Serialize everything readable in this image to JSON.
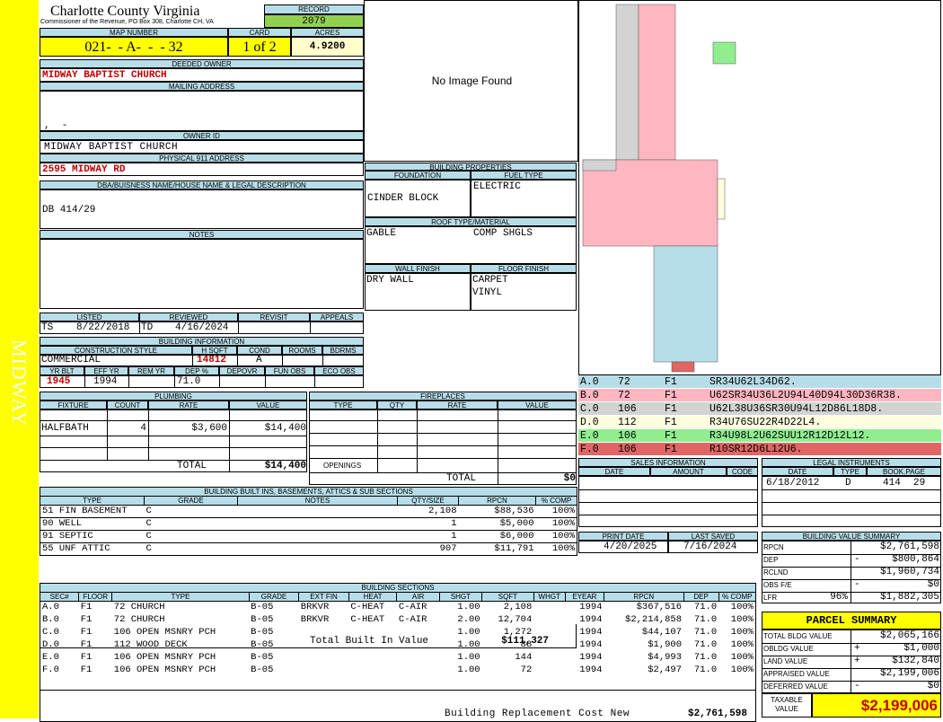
{
  "side_label": "MIDWAY",
  "header": {
    "county": "Charlotte County Virginia",
    "commissioner": "Commissioner of the Revenue, PO Box 308, Charlotte CH, VA",
    "record_label": "RECORD",
    "record": "2079",
    "map_label": "MAP NUMBER",
    "map_number": "021-  - A-  -  - 32",
    "card_label": "CARD",
    "card": "1 of 2",
    "acres_label": "ACRES",
    "acres": "4.9200"
  },
  "owner": {
    "deeded_label": "DEEDED OWNER",
    "deeded": "MIDWAY BAPTIST CHURCH",
    "mailing_label": "MAILING ADDRESS",
    "mailing": ",  -",
    "owner_id_label": "OWNER ID",
    "owner_id": "MIDWAY BAPTIST CHURCH",
    "physical_label": "PHYSICAL 911 ADDRESS",
    "physical": "2595 MIDWAY RD",
    "dba_label": "DBA/BUISNESS NAME/HOUSE NAME & LEGAL DESCRIPTION",
    "dba": "DB 414/29",
    "notes_label": "NOTES"
  },
  "image": {
    "text": "No Image Found"
  },
  "bldg_props": {
    "title": "BUILDING PROPERTIES",
    "foundation_label": "FOUNDATION",
    "foundation": "CINDER BLOCK",
    "fuel_label": "FUEL TYPE",
    "fuel": "ELECTRIC",
    "roof_label": "ROOF TYPE/MATERIAL",
    "roof_type": "GABLE",
    "roof_material": "COMP SHGLS",
    "wall_label": "WALL FINISH",
    "wall": "DRY WALL",
    "floor_label": "FLOOR FINISH",
    "floor1": "CARPET",
    "floor2": "VINYL"
  },
  "status": {
    "listed_label": "LISTED",
    "reviewed_label": "REVIEWED",
    "revisit_label": "REVISIT",
    "appeals_label": "APPEALS",
    "listed_by": "TS",
    "listed_date": "8/22/2018",
    "reviewed_by": "TD",
    "reviewed_date": "4/16/2024"
  },
  "bldg_info": {
    "title": "BUILDING INFORMATION",
    "style_label": "CONSTRUCTION STYLE",
    "hsqft_label": "H SQFT",
    "cond_label": "COND",
    "rooms_label": "ROOMS",
    "bdrms_label": "BDRMS",
    "style": "COMMERCIAL",
    "hsqft": "14812",
    "cond": "A",
    "yrblt_label": "YR BLT",
    "effyr_label": "EFF YR",
    "remyr_label": "REM YR",
    "dep_label": "DEP %",
    "depovr_label": "DEPOVR",
    "funobs_label": "FUN OBS",
    "ecoobs_label": "ECO OBS",
    "yrblt": "1945",
    "effyr": "1994",
    "dep": "71.0"
  },
  "plumbing": {
    "title": "PLUMBING",
    "headers": [
      "FIXTURE",
      "COUNT",
      "RATE",
      "VALUE"
    ],
    "fixture": "HALFBATH",
    "count": "4",
    "rate": "$3,600",
    "value": "$14,400",
    "total_label": "TOTAL",
    "total": "$14,400"
  },
  "fireplaces": {
    "title": "FIREPLACES",
    "headers": [
      "TYPE",
      "QTY",
      "RATE",
      "VALUE"
    ],
    "openings_label": "OPENINGS",
    "total_label": "TOTAL",
    "total": "$0"
  },
  "builtins": {
    "title": "BUILDING BUILT INS, BASEMENTS, ATTICS & SUB SECTIONS",
    "headers": [
      "TYPE",
      "GRADE",
      "NOTES",
      "QTY/SIZE",
      "RPCN",
      "% COMP"
    ],
    "rows": [
      [
        "51 FIN BASEMENT",
        "C",
        "",
        "2,108",
        "$88,536",
        "100%"
      ],
      [
        "90 WELL",
        "C",
        "",
        "1",
        "$5,000",
        "100%"
      ],
      [
        "91 SEPTIC",
        "C",
        "",
        "1",
        "$6,000",
        "100%"
      ],
      [
        "55 UNF ATTIC",
        "C",
        "",
        "907",
        "$11,791",
        "100%"
      ]
    ],
    "total_label": "Total Built In Value",
    "total": "$111,327"
  },
  "sections": {
    "title": "BUILDING SECTIONS",
    "headers": [
      "SEC#",
      "FLOOR",
      "TYPE",
      "GRADE",
      "EXT FIN",
      "HEAT",
      "AIR",
      "SHGT",
      "SQFT",
      "WHGT",
      "EYEAR",
      "RPCN",
      "DEP",
      "% COMP"
    ],
    "rows": [
      [
        "A.0",
        "F1",
        "72 CHURCH",
        "B-05",
        "BRKVR",
        "C-HEAT",
        "C-AIR",
        "1.00",
        "2,108",
        "",
        "1994",
        "$367,516",
        "71.0",
        "100%"
      ],
      [
        "B.0",
        "F1",
        "72 CHURCH",
        "B-05",
        "BRKVR",
        "C-HEAT",
        "C-AIR",
        "2.00",
        "12,704",
        "",
        "1994",
        "$2,214,858",
        "71.0",
        "100%"
      ],
      [
        "C.0",
        "F1",
        "106 OPEN MSNRY PCH",
        "B-05",
        "",
        "",
        "",
        "1.00",
        "1,272",
        "",
        "1994",
        "$44,107",
        "71.0",
        "100%"
      ],
      [
        "D.0",
        "F1",
        "112 WOOD DECK",
        "B-05",
        "",
        "",
        "",
        "1.00",
        "88",
        "",
        "1994",
        "$1,900",
        "71.0",
        "100%"
      ],
      [
        "E.0",
        "F1",
        "106 OPEN MSNRY PCH",
        "B-05",
        "",
        "",
        "",
        "1.00",
        "144",
        "",
        "1994",
        "$4,993",
        "71.0",
        "100%"
      ],
      [
        "F.0",
        "F1",
        "106 OPEN MSNRY PCH",
        "B-05",
        "",
        "",
        "",
        "1.00",
        "72",
        "",
        "1994",
        "$2,497",
        "71.0",
        "100%"
      ]
    ],
    "total_label": "Building Replacement Cost New",
    "total": "$2,761,598"
  },
  "sketch_legend": [
    {
      "sec": "A.0",
      "code": "72",
      "floor": "F1",
      "path": "SR34U62L34D62.",
      "color": "#b7dde8"
    },
    {
      "sec": "B.0",
      "code": "72",
      "floor": "F1",
      "path": "U62SR34U36L2U94L40D94L30D36R38.",
      "color": "#ffb6c1"
    },
    {
      "sec": "C.0",
      "code": "106",
      "floor": "F1",
      "path": "U62L38U36SR30U94L12D86L18D8.",
      "color": "#d3d3d3"
    },
    {
      "sec": "D.0",
      "code": "112",
      "floor": "F1",
      "path": "R34U76SU22R4D22L4.",
      "color": "#ffffe0"
    },
    {
      "sec": "E.0",
      "code": "106",
      "floor": "F1",
      "path": "R34U98L2U62SUU12R12D12L12.",
      "color": "#90ee90"
    },
    {
      "sec": "F.0",
      "code": "106",
      "floor": "F1",
      "path": "R10SR12D6L12U6.",
      "color": "#e06666"
    }
  ],
  "sales": {
    "title": "SALES INFORMATION",
    "headers": [
      "DATE",
      "AMOUNT",
      "CODE"
    ]
  },
  "legal": {
    "title": "LEGAL INSTRUMENTS",
    "headers": [
      "DATE",
      "TYPE",
      "BOOK.PAGE"
    ],
    "date": "6/18/2012",
    "type": "D",
    "book": "414",
    "page": "29"
  },
  "dates": {
    "print_label": "PRINT DATE",
    "print": "4/20/2025",
    "saved_label": "LAST SAVED",
    "saved": "7/16/2024"
  },
  "value_summary": {
    "title": "BUILDING VALUE SUMMARY",
    "rpcn_label": "RPCN",
    "rpcn": "$2,761,598",
    "dep_label": "DEP",
    "dep_sign": "-",
    "dep": "$800,864",
    "rclnd_label": "RCLND",
    "rclnd": "$1,960,734",
    "obs_label": "OBS F/E",
    "obs_sign": "-",
    "obs": "$0",
    "lfr_label": "LFR",
    "lfr_pct": "96%",
    "lfr": "$1,882,305"
  },
  "parcel": {
    "title": "PARCEL SUMMARY",
    "total_bldg_label": "TOTAL BLDG VALUE",
    "total_bldg": "$2,065,166",
    "obldg_label": "OBLDG VALUE",
    "obldg_sign": "+",
    "obldg": "$1,000",
    "land_label": "LAND VALUE",
    "land_sign": "+",
    "land": "$132,840",
    "appraised_label": "APPRAISED VALUE",
    "appraised": "$2,199,006",
    "deferred_label": "DEFERRED VALUE",
    "deferred_sign": "-",
    "deferred": "$0",
    "taxable_label1": "TAXABLE",
    "taxable_label2": "VALUE",
    "taxable": "$2,199,006"
  }
}
